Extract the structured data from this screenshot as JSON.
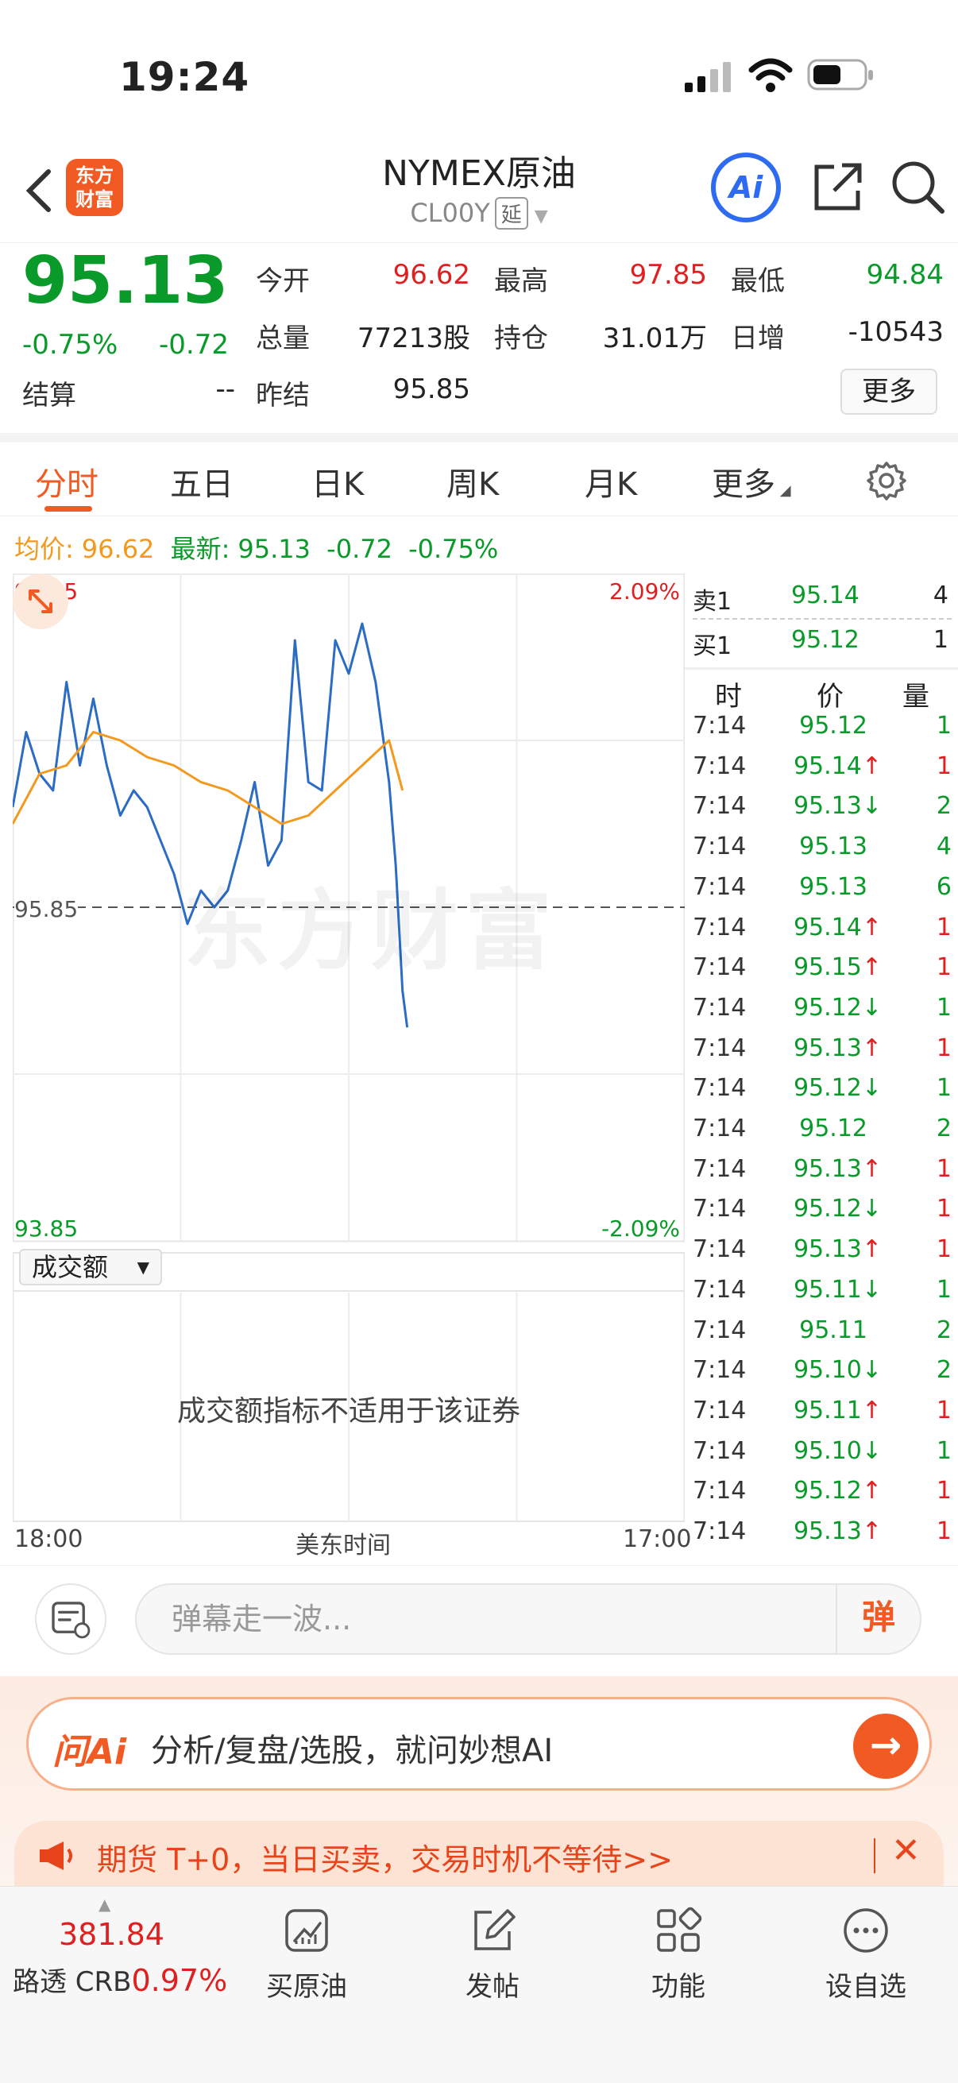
{
  "status_bar": {
    "time": "19:24"
  },
  "header": {
    "title": "NYMEX原油",
    "code": "CL00Y",
    "delay_tag": "延",
    "logo_text_line1": "东方",
    "logo_text_line2": "财富",
    "ai_label": "Ai"
  },
  "quote": {
    "price": "95.13",
    "change_pct": "-0.75%",
    "change": "-0.72",
    "open_label": "今开",
    "open": "96.62",
    "high_label": "最高",
    "high": "97.85",
    "low_label": "最低",
    "low": "94.84",
    "volume_label": "总量",
    "volume": "77213股",
    "oi_label": "持仓",
    "oi": "31.01万",
    "daily_inc_label": "日增",
    "daily_inc": "-10543",
    "settle_label": "结算",
    "settle": "--",
    "prev_settle_label": "昨结",
    "prev_settle": "95.85",
    "more_label": "更多"
  },
  "tabs": [
    "分时",
    "五日",
    "日K",
    "周K",
    "月K",
    "更多"
  ],
  "avg_line": {
    "avg_label": "均价:",
    "avg": "96.62",
    "latest_label": "最新:",
    "latest": "95.13",
    "change": "-0.72",
    "change_pct": "-0.75%"
  },
  "chart_data": {
    "type": "line",
    "title": "",
    "xlabel": "美东时间",
    "x_start": "18:00",
    "x_end": "17:00",
    "ymax_label": "97.85",
    "ymin_label": "93.85",
    "mid_label": "95.85",
    "ylim": [
      93.85,
      97.85
    ],
    "right_max_label": "2.09%",
    "right_min_label": "-2.09%",
    "prev_close": 95.85,
    "grid": true,
    "series": [
      {
        "color": "#2b6cc4",
        "x": [
          0,
          2,
          4,
          6,
          8,
          10,
          12,
          14,
          16,
          18,
          20,
          22,
          24,
          26,
          28,
          30,
          32,
          34,
          36,
          38,
          40,
          42,
          44,
          46,
          48,
          50,
          52,
          54,
          55,
          56,
          57,
          58,
          58.7
        ],
        "values": [
          96.45,
          96.9,
          96.65,
          96.55,
          97.2,
          96.7,
          97.1,
          96.7,
          96.4,
          96.55,
          96.45,
          96.25,
          96.05,
          95.75,
          95.95,
          95.85,
          95.95,
          96.25,
          96.6,
          96.1,
          96.25,
          97.45,
          96.6,
          96.55,
          97.45,
          97.25,
          97.55,
          97.2,
          96.9,
          96.6,
          96.1,
          95.35,
          95.13
        ]
      },
      {
        "color": "#f39a1e",
        "x": [
          0,
          4,
          8,
          12,
          16,
          20,
          24,
          28,
          32,
          36,
          40,
          44,
          48,
          52,
          56,
          58
        ],
        "values": [
          96.35,
          96.65,
          96.7,
          96.9,
          96.85,
          96.75,
          96.7,
          96.6,
          96.55,
          96.45,
          96.35,
          96.4,
          96.55,
          96.7,
          96.85,
          96.55
        ]
      }
    ],
    "x_total": 100
  },
  "volume_panel": {
    "select_label": "成交额",
    "message": "成交额指标不适用于该证券"
  },
  "order_book": {
    "ask_label": "卖1",
    "ask_price": "95.14",
    "ask_vol": "4",
    "bid_label": "买1",
    "bid_price": "95.12",
    "bid_vol": "1"
  },
  "ticks": {
    "headers": [
      "时",
      "价",
      "量"
    ],
    "rows": [
      {
        "time": "7:14",
        "price": "95.12",
        "arrow": "",
        "vol": "1",
        "vcolor": "green"
      },
      {
        "time": "7:14",
        "price": "95.14",
        "arrow": "↑",
        "vol": "1",
        "vcolor": "red"
      },
      {
        "time": "7:14",
        "price": "95.13",
        "arrow": "↓",
        "vol": "2",
        "vcolor": "green"
      },
      {
        "time": "7:14",
        "price": "95.13",
        "arrow": "",
        "vol": "4",
        "vcolor": "green"
      },
      {
        "time": "7:14",
        "price": "95.13",
        "arrow": "",
        "vol": "6",
        "vcolor": "green"
      },
      {
        "time": "7:14",
        "price": "95.14",
        "arrow": "↑",
        "vol": "1",
        "vcolor": "red"
      },
      {
        "time": "7:14",
        "price": "95.15",
        "arrow": "↑",
        "vol": "1",
        "vcolor": "red"
      },
      {
        "time": "7:14",
        "price": "95.12",
        "arrow": "↓",
        "vol": "1",
        "vcolor": "green"
      },
      {
        "time": "7:14",
        "price": "95.13",
        "arrow": "↑",
        "vol": "1",
        "vcolor": "red"
      },
      {
        "time": "7:14",
        "price": "95.12",
        "arrow": "↓",
        "vol": "1",
        "vcolor": "green"
      },
      {
        "time": "7:14",
        "price": "95.12",
        "arrow": "",
        "vol": "2",
        "vcolor": "green"
      },
      {
        "time": "7:14",
        "price": "95.13",
        "arrow": "↑",
        "vol": "1",
        "vcolor": "red"
      },
      {
        "time": "7:14",
        "price": "95.12",
        "arrow": "↓",
        "vol": "1",
        "vcolor": "red"
      },
      {
        "time": "7:14",
        "price": "95.13",
        "arrow": "↑",
        "vol": "1",
        "vcolor": "red"
      },
      {
        "time": "7:14",
        "price": "95.11",
        "arrow": "↓",
        "vol": "1",
        "vcolor": "green"
      },
      {
        "time": "7:14",
        "price": "95.11",
        "arrow": "",
        "vol": "2",
        "vcolor": "green"
      },
      {
        "time": "7:14",
        "price": "95.10",
        "arrow": "↓",
        "vol": "2",
        "vcolor": "green"
      },
      {
        "time": "7:14",
        "price": "95.11",
        "arrow": "↑",
        "vol": "1",
        "vcolor": "red"
      },
      {
        "time": "7:14",
        "price": "95.10",
        "arrow": "↓",
        "vol": "1",
        "vcolor": "green"
      },
      {
        "time": "7:14",
        "price": "95.12",
        "arrow": "↑",
        "vol": "1",
        "vcolor": "red"
      },
      {
        "time": "7:14",
        "price": "95.13",
        "arrow": "↑",
        "vol": "1",
        "vcolor": "red"
      }
    ]
  },
  "danmaku": {
    "placeholder": "弹幕走一波...",
    "button": "弹"
  },
  "ask_ai": {
    "brand": "问Ai",
    "text": "分析/复盘/选股，就问妙想AI",
    "go": "→"
  },
  "promo": {
    "text": "期货 T+0，当日买卖，交易时机不等待>>",
    "close": "✕"
  },
  "bottom_nav": {
    "index_value": "381.84",
    "index_name": "路透 CRB",
    "index_pct": "0.97%",
    "items": [
      "买原油",
      "发帖",
      "功能",
      "设自选"
    ]
  },
  "colors": {
    "brand": "#f15a22",
    "up": "#e02020",
    "down": "#0a9a2a",
    "price_line": "#2b6cc4",
    "avg_line": "#f39a1e"
  }
}
